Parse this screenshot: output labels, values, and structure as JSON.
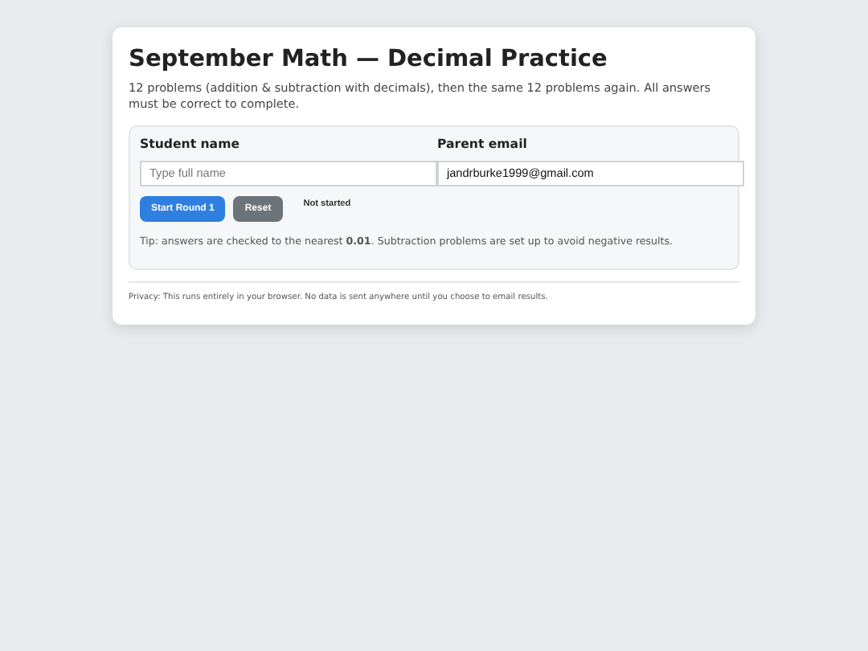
{
  "title": "September Math — Decimal Practice",
  "description": "12 problems (addition & subtraction with decimals), then the same 12 problems again. All answers must be correct to complete.",
  "fields": [
    {
      "label": "Student name",
      "placeholder": "Type full name"
    },
    {
      "label": "Parent email",
      "value": "jandrburke1999@gmail.com"
    }
  ],
  "buttons": [
    {
      "label": "Start Round 1",
      "kind": "primary"
    },
    {
      "label": "Reset",
      "kind": "secondary"
    }
  ],
  "status": "Not started",
  "tip": "Tip: answers are checked to the nearest **0.01**. Subtraction problems are set up to avoid negative results.",
  "privacy": "Privacy: This runs entirely in your browser. No data is sent anywhere until you choose to email results."
}
